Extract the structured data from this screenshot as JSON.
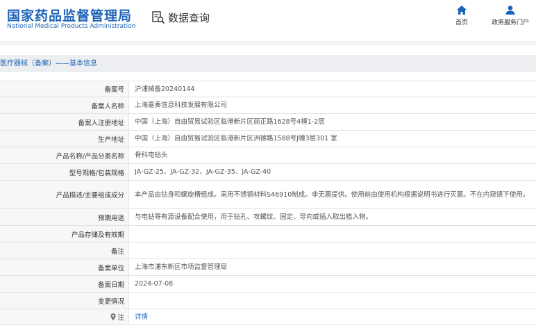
{
  "header": {
    "logo_cn": "国家药品监督管理局",
    "logo_en": "National Medical Products Administration",
    "query_label": "数据查询",
    "nav": [
      {
        "label": "首页",
        "icon": "home-icon"
      },
      {
        "label": "政务服务门户",
        "icon": "user-icon"
      }
    ]
  },
  "breadcrumb": "医疗器械（备案）——基本信息",
  "rows": [
    {
      "label": "备案号",
      "value": "沪浦械备20240144"
    },
    {
      "label": "备案人名称",
      "value": "上海嘉奏信息科技发展有限公司"
    },
    {
      "label": "备案人注册地址",
      "value": "中国（上海）自由贸易试验区临港新片区丽正路1628号4幢1-2层"
    },
    {
      "label": "生产地址",
      "value": "中国（上海）自由贸易试验区临港新片区洲德路1588号J幢3层301 室"
    },
    {
      "label": "产品名称/产品分类名称",
      "value": "骨科电钻头"
    },
    {
      "label": "型号规格/包装规格",
      "value": "JA-GZ-25、JA-GZ-32、JA-GZ-35、JA-GZ-40"
    },
    {
      "label": "产品描述/主要组成成分",
      "value": "本产品由钻身和螺旋槽组成。采用不锈钢材料S46910制成。非无菌提供。使用前由使用机构根据说明书进行灭菌。不在内窥镜下使用。"
    },
    {
      "label": "预期用途",
      "value": "与电钻等有源设备配合使用，用于钻孔、攻螺纹、固定、导向或插入取出植入物。"
    },
    {
      "label": "产品存储及有效期",
      "value": ""
    },
    {
      "label": "备注",
      "value": ""
    },
    {
      "label": "备案单位",
      "value": "上海市浦东新区市场监督管理局"
    },
    {
      "label": "备案日期",
      "value": "2024-07-08"
    },
    {
      "label": "变更情况",
      "value": ""
    }
  ],
  "note_row": {
    "label": "注",
    "link": "详情",
    "icon": "pin-icon"
  },
  "colors": {
    "brand": "#1d63b7",
    "label_bg": "#f7f7f7",
    "border": "#e2e2e2"
  }
}
